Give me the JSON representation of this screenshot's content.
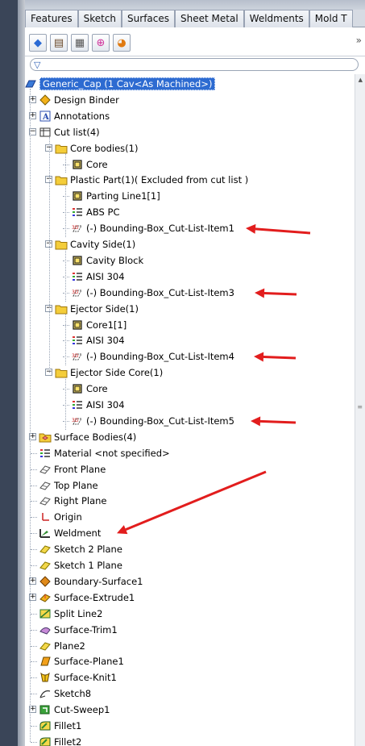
{
  "tabs": [
    "Features",
    "Sketch",
    "Surfaces",
    "Sheet Metal",
    "Weldments",
    "Mold T"
  ],
  "toolbar_icons": [
    "feature-manager-icon",
    "property-manager-icon",
    "configuration-manager-icon",
    "dimxpert-icon",
    "display-manager-icon"
  ],
  "overflow_label": "»",
  "filter_icon": "filter-icon",
  "tree": {
    "root_label": "Generic_Cap  (1 Cav<As Machined>)",
    "items": [
      {
        "label": "Design Binder",
        "icon": "design-binder-icon",
        "level": 0,
        "expander": "+"
      },
      {
        "label": "Annotations",
        "icon": "annotations-icon",
        "level": 0,
        "expander": "+"
      },
      {
        "label": "Cut list(4)",
        "icon": "cut-list-icon",
        "level": 0,
        "expander": "-"
      },
      {
        "label": "Core bodies(1)",
        "icon": "folder-icon",
        "level": 1,
        "expander": "-"
      },
      {
        "label": "Core",
        "icon": "solid-body-icon",
        "level": 2,
        "expander": ""
      },
      {
        "label": "Plastic Part(1)( Excluded from cut list )",
        "icon": "folder-icon",
        "level": 1,
        "expander": "-"
      },
      {
        "label": "Parting Line1[1]",
        "icon": "solid-body-icon",
        "level": 2,
        "expander": ""
      },
      {
        "label": "ABS PC",
        "icon": "material-icon",
        "level": 2,
        "expander": ""
      },
      {
        "label": "(-) Bounding-Box_Cut-List-Item1",
        "icon": "bounding-box-icon",
        "level": 2,
        "expander": ""
      },
      {
        "label": "Cavity Side(1)",
        "icon": "folder-icon",
        "level": 1,
        "expander": "-"
      },
      {
        "label": "Cavity Block",
        "icon": "solid-body-icon",
        "level": 2,
        "expander": ""
      },
      {
        "label": "AISI 304",
        "icon": "material-icon",
        "level": 2,
        "expander": ""
      },
      {
        "label": "(-) Bounding-Box_Cut-List-Item3",
        "icon": "bounding-box-icon",
        "level": 2,
        "expander": ""
      },
      {
        "label": "Ejector Side(1)",
        "icon": "folder-icon",
        "level": 1,
        "expander": "-"
      },
      {
        "label": "Core1[1]",
        "icon": "solid-body-icon",
        "level": 2,
        "expander": ""
      },
      {
        "label": "AISI 304",
        "icon": "material-icon",
        "level": 2,
        "expander": ""
      },
      {
        "label": "(-) Bounding-Box_Cut-List-Item4",
        "icon": "bounding-box-icon",
        "level": 2,
        "expander": ""
      },
      {
        "label": "Ejector Side Core(1)",
        "icon": "folder-icon",
        "level": 1,
        "expander": "-"
      },
      {
        "label": "Core",
        "icon": "solid-body-icon",
        "level": 2,
        "expander": ""
      },
      {
        "label": "AISI 304",
        "icon": "material-icon",
        "level": 2,
        "expander": ""
      },
      {
        "label": "(-) Bounding-Box_Cut-List-Item5",
        "icon": "bounding-box-icon",
        "level": 2,
        "expander": ""
      },
      {
        "label": "Surface Bodies(4)",
        "icon": "surface-bodies-icon",
        "level": 0,
        "expander": "+"
      },
      {
        "label": "Material <not specified>",
        "icon": "material-icon",
        "level": 0,
        "expander": ""
      },
      {
        "label": "Front Plane",
        "icon": "plane-icon",
        "level": 0,
        "expander": ""
      },
      {
        "label": "Top Plane",
        "icon": "plane-icon",
        "level": 0,
        "expander": ""
      },
      {
        "label": "Right Plane",
        "icon": "plane-icon",
        "level": 0,
        "expander": ""
      },
      {
        "label": "Origin",
        "icon": "origin-icon",
        "level": 0,
        "expander": ""
      },
      {
        "label": "Weldment",
        "icon": "weldment-icon",
        "level": 0,
        "expander": ""
      },
      {
        "label": "Sketch 2 Plane",
        "icon": "ref-plane-icon",
        "level": 0,
        "expander": ""
      },
      {
        "label": "Sketch 1 Plane",
        "icon": "ref-plane-icon",
        "level": 0,
        "expander": ""
      },
      {
        "label": "Boundary-Surface1",
        "icon": "boundary-surface-icon",
        "level": 0,
        "expander": "+"
      },
      {
        "label": "Surface-Extrude1",
        "icon": "surface-extrude-icon",
        "level": 0,
        "expander": "+"
      },
      {
        "label": "Split Line2",
        "icon": "split-line-icon",
        "level": 0,
        "expander": ""
      },
      {
        "label": "Surface-Trim1",
        "icon": "surface-trim-icon",
        "level": 0,
        "expander": ""
      },
      {
        "label": "Plane2",
        "icon": "ref-plane-icon",
        "level": 0,
        "expander": ""
      },
      {
        "label": "Surface-Plane1",
        "icon": "surface-plane-icon",
        "level": 0,
        "expander": ""
      },
      {
        "label": "Surface-Knit1",
        "icon": "surface-knit-icon",
        "level": 0,
        "expander": ""
      },
      {
        "label": "Sketch8",
        "icon": "sketch-icon",
        "level": 0,
        "expander": ""
      },
      {
        "label": "Cut-Sweep1",
        "icon": "cut-sweep-icon",
        "level": 0,
        "expander": "+"
      },
      {
        "label": "Fillet1",
        "icon": "fillet-icon",
        "level": 0,
        "expander": ""
      },
      {
        "label": "Fillet2",
        "icon": "fillet-icon",
        "level": 0,
        "expander": ""
      }
    ]
  },
  "annotation_arrow_color": "#e21d1d",
  "selection_color": "#2d6bd1"
}
